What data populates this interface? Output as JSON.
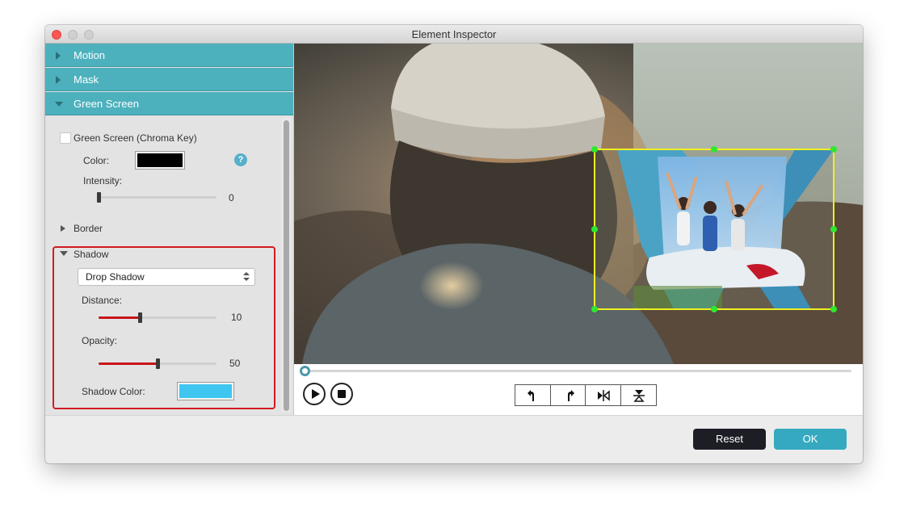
{
  "window": {
    "title": "Element Inspector"
  },
  "sections": {
    "motion": "Motion",
    "mask": "Mask",
    "green_screen": "Green Screen"
  },
  "green_screen": {
    "checkbox_label": "Green Screen (Chroma Key)",
    "checked": false,
    "color_label": "Color:",
    "color_value": "#000000",
    "help_label": "?",
    "intensity_label": "Intensity:",
    "intensity_value": "0",
    "intensity_fraction": 0
  },
  "border": {
    "label": "Border"
  },
  "shadow": {
    "label": "Shadow",
    "type_selected": "Drop Shadow",
    "distance_label": "Distance:",
    "distance_value": "10",
    "distance_fraction": 0.35,
    "opacity_label": "Opacity:",
    "opacity_value": "50",
    "opacity_fraction": 0.5,
    "color_label": "Shadow Color:",
    "color_value": "#3ec6f0"
  },
  "playback": {
    "position_fraction": 0
  },
  "buttons": {
    "reset": "Reset",
    "ok": "OK"
  },
  "colors": {
    "accent": "#4cb1bd",
    "highlight": "#d21b22",
    "selection": "#f0f020",
    "handle": "#2ee82e"
  }
}
